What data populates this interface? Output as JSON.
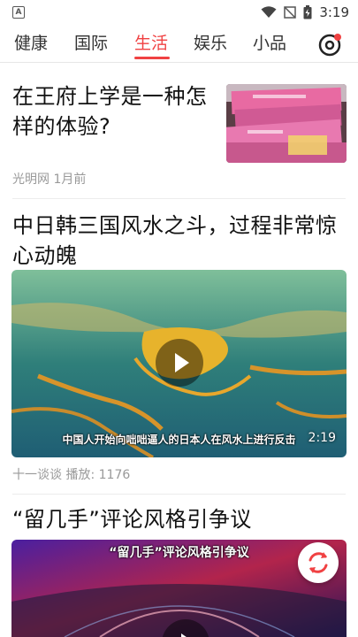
{
  "status": {
    "time": "3:19",
    "app_icon_letter": "A"
  },
  "tabs": [
    "健康",
    "国际",
    "生活",
    "娱乐",
    "小品"
  ],
  "active_tab": "生活",
  "articles": [
    {
      "title_line1": "在王府上学是一种怎",
      "title_line2": "样的体验?",
      "source": "光明网",
      "time": "1月前"
    },
    {
      "title_line1": "中日韩三国风水之斗，过程非常惊",
      "title_line2": "心动魄",
      "caption": "中国人开始向咄咄逼人的日本人在风水上进行反击",
      "duration": "2:19",
      "author": "十一谈谈",
      "plays_label": "播放:",
      "plays": "1176"
    },
    {
      "title": "“留几手”评论风格引争议",
      "banner_text": "“留几手”评论风格引争议"
    }
  ],
  "colors": {
    "accent": "#f04142"
  }
}
